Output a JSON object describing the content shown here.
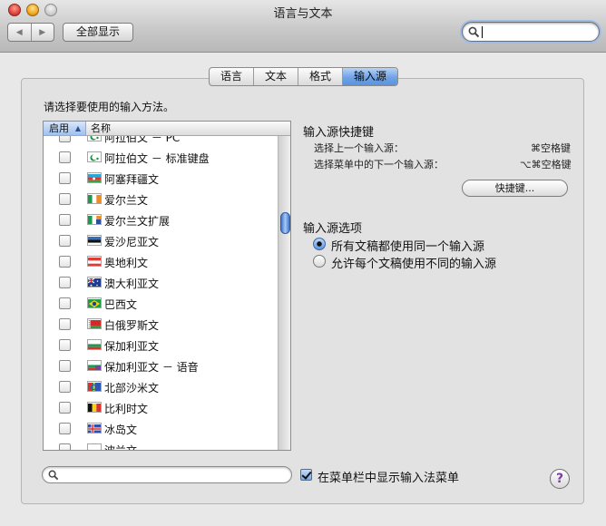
{
  "window": {
    "title": "语言与文本"
  },
  "toolbar": {
    "back_icon": "◀",
    "forward_icon": "▶",
    "show_all": "全部显示",
    "search_value": ""
  },
  "tabs": [
    {
      "label": "语言",
      "active": false
    },
    {
      "label": "文本",
      "active": false
    },
    {
      "label": "格式",
      "active": false
    },
    {
      "label": "输入源",
      "active": true
    }
  ],
  "prompt": "请选择要使用的输入方法。",
  "list": {
    "col_enable": "启用",
    "col_name": "名称",
    "sort_icon": "▲",
    "rows": [
      {
        "flag": "arabic",
        "label": "阿拉伯文 － PC",
        "checked": false
      },
      {
        "flag": "arabic",
        "label": "阿拉伯文 － 标准键盘",
        "checked": false
      },
      {
        "flag": "azerbaijan",
        "label": "阿塞拜疆文",
        "checked": false
      },
      {
        "flag": "ireland",
        "label": "爱尔兰文",
        "checked": false
      },
      {
        "flag": "ireland-ext",
        "label": "爱尔兰文扩展",
        "checked": false
      },
      {
        "flag": "estonia",
        "label": "爱沙尼亚文",
        "checked": false
      },
      {
        "flag": "austria",
        "label": "奥地利文",
        "checked": false
      },
      {
        "flag": "australia",
        "label": "澳大利亚文",
        "checked": false
      },
      {
        "flag": "brazil",
        "label": "巴西文",
        "checked": false
      },
      {
        "flag": "belarus",
        "label": "白俄罗斯文",
        "checked": false
      },
      {
        "flag": "bulgaria",
        "label": "保加利亚文",
        "checked": false
      },
      {
        "flag": "bulgaria-phonetic",
        "label": "保加利亚文 － 语音",
        "checked": false
      },
      {
        "flag": "sami",
        "label": "北部沙米文",
        "checked": false
      },
      {
        "flag": "belgium",
        "label": "比利时文",
        "checked": false
      },
      {
        "flag": "iceland",
        "label": "冰岛文",
        "checked": false
      },
      {
        "flag": "poland",
        "label": "波兰文",
        "checked": false
      }
    ]
  },
  "shortcuts": {
    "title": "输入源快捷键",
    "prev_label": "选择上一个输入源：",
    "prev_key": "⌘空格键",
    "next_label": "选择菜单中的下一个输入源：",
    "next_key": "⌥⌘空格键",
    "button": "快捷键..."
  },
  "options": {
    "title": "输入源选项",
    "radio_same": "所有文稿都使用同一个输入源",
    "radio_diff": "允许每个文稿使用不同的输入源",
    "selected": "same"
  },
  "bottom": {
    "search_value": "",
    "menu_checkbox": "在菜单栏中显示输入法菜单",
    "menu_checked": true,
    "help": "?"
  }
}
